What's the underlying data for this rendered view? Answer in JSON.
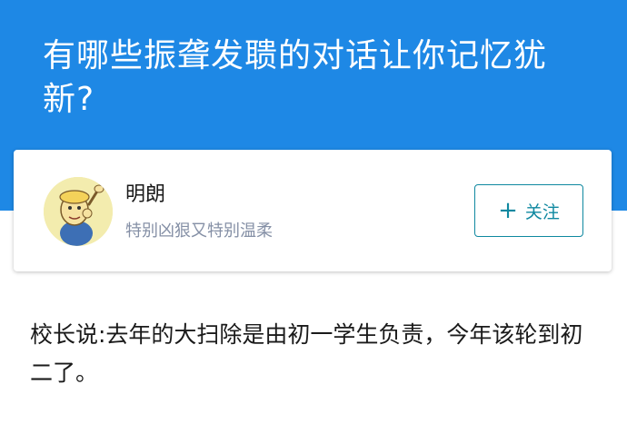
{
  "question": {
    "title": "有哪些振聋发聩的对话让你记忆犹新?"
  },
  "author": {
    "name": "明朗",
    "bio": "特别凶狠又特别温柔",
    "avatar_icon": "cartoon-avatar"
  },
  "follow_button": {
    "icon": "+",
    "label": "关注"
  },
  "answer": {
    "text": "校长说:去年的大扫除是由初一学生负责，今年该轮到初二了。"
  },
  "colors": {
    "header_bg": "#1e88e5",
    "accent": "#0f88a0"
  }
}
